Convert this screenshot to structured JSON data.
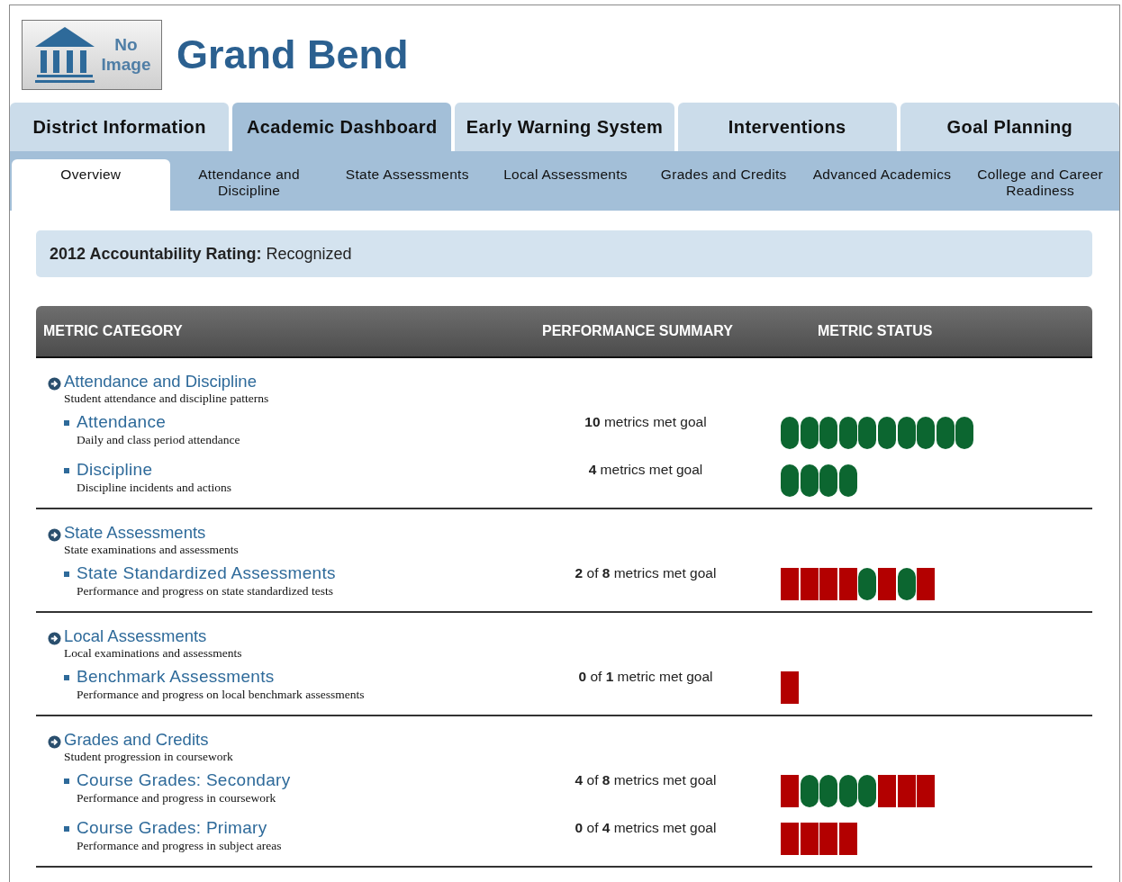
{
  "header": {
    "logo_text": [
      "No",
      "Image"
    ],
    "title": "Grand Bend"
  },
  "main_tabs": [
    {
      "label": "District Information",
      "selected": false
    },
    {
      "label": "Academic Dashboard",
      "selected": true
    },
    {
      "label": "Early Warning System",
      "selected": false
    },
    {
      "label": "Interventions",
      "selected": false
    },
    {
      "label": "Goal Planning",
      "selected": false
    }
  ],
  "sub_tabs": [
    {
      "label": "Overview",
      "selected": true
    },
    {
      "label": "Attendance and Discipline",
      "selected": false
    },
    {
      "label": "State Assessments",
      "selected": false
    },
    {
      "label": "Local Assessments",
      "selected": false
    },
    {
      "label": "Grades and Credits",
      "selected": false
    },
    {
      "label": "Advanced Academics",
      "selected": false
    },
    {
      "label": "College and Career Readiness",
      "selected": false
    }
  ],
  "rating": "**2012 Accountability Rating:** Recognized",
  "table": {
    "columns": [
      "METRIC CATEGORY",
      "PERFORMANCE SUMMARY",
      "METRIC STATUS"
    ],
    "categories": [
      {
        "title": "Attendance and Discipline",
        "description": "Student attendance and discipline patterns",
        "items": [
          {
            "title": "Attendance",
            "description": "Daily and class period attendance",
            "summary": "**10** metrics met goal",
            "status": [
              {
                "met": true
              },
              {
                "met": true
              },
              {
                "met": true
              },
              {
                "met": true
              },
              {
                "met": true
              },
              {
                "met": true
              },
              {
                "met": true
              },
              {
                "met": true
              },
              {
                "met": true
              },
              {
                "met": true
              }
            ]
          },
          {
            "title": "Discipline",
            "description": "Discipline incidents and actions",
            "summary": "**4** metrics met goal",
            "status": [
              {
                "met": true
              },
              {
                "met": true
              },
              {
                "met": true
              },
              {
                "met": true
              }
            ]
          }
        ]
      },
      {
        "title": "State Assessments",
        "description": "State examinations and assessments",
        "items": [
          {
            "title": "State Standardized Assessments",
            "description": "Performance and progress on state standardized tests",
            "summary": "**2** of **8** metrics met goal",
            "status": [
              {
                "met": false
              },
              {
                "met": false
              },
              {
                "met": false
              },
              {
                "met": false
              },
              {
                "met": true
              },
              {
                "met": false
              },
              {
                "met": true
              },
              {
                "met": false
              }
            ]
          }
        ]
      },
      {
        "title": "Local Assessments",
        "description": "Local examinations and assessments",
        "items": [
          {
            "title": "Benchmark Assessments",
            "description": "Performance and progress on local benchmark assessments",
            "summary": "**0** of **1** metric met goal",
            "status": [
              {
                "met": false
              }
            ]
          }
        ]
      },
      {
        "title": "Grades and Credits",
        "description": "Student progression in coursework",
        "items": [
          {
            "title": "Course Grades: Secondary",
            "description": "Performance and progress in coursework",
            "summary": "**4** of **8** metrics met goal",
            "status": [
              {
                "met": false
              },
              {
                "met": true
              },
              {
                "met": true
              },
              {
                "met": true
              },
              {
                "met": true
              },
              {
                "met": false
              },
              {
                "met": false
              },
              {
                "met": false
              }
            ]
          },
          {
            "title": "Course Grades: Primary",
            "description": "Performance and progress in subject areas",
            "summary": "**0** of **4** metrics met goal",
            "status": [
              {
                "met": false
              },
              {
                "met": false
              },
              {
                "met": false
              },
              {
                "met": false
              }
            ]
          }
        ]
      }
    ]
  }
}
